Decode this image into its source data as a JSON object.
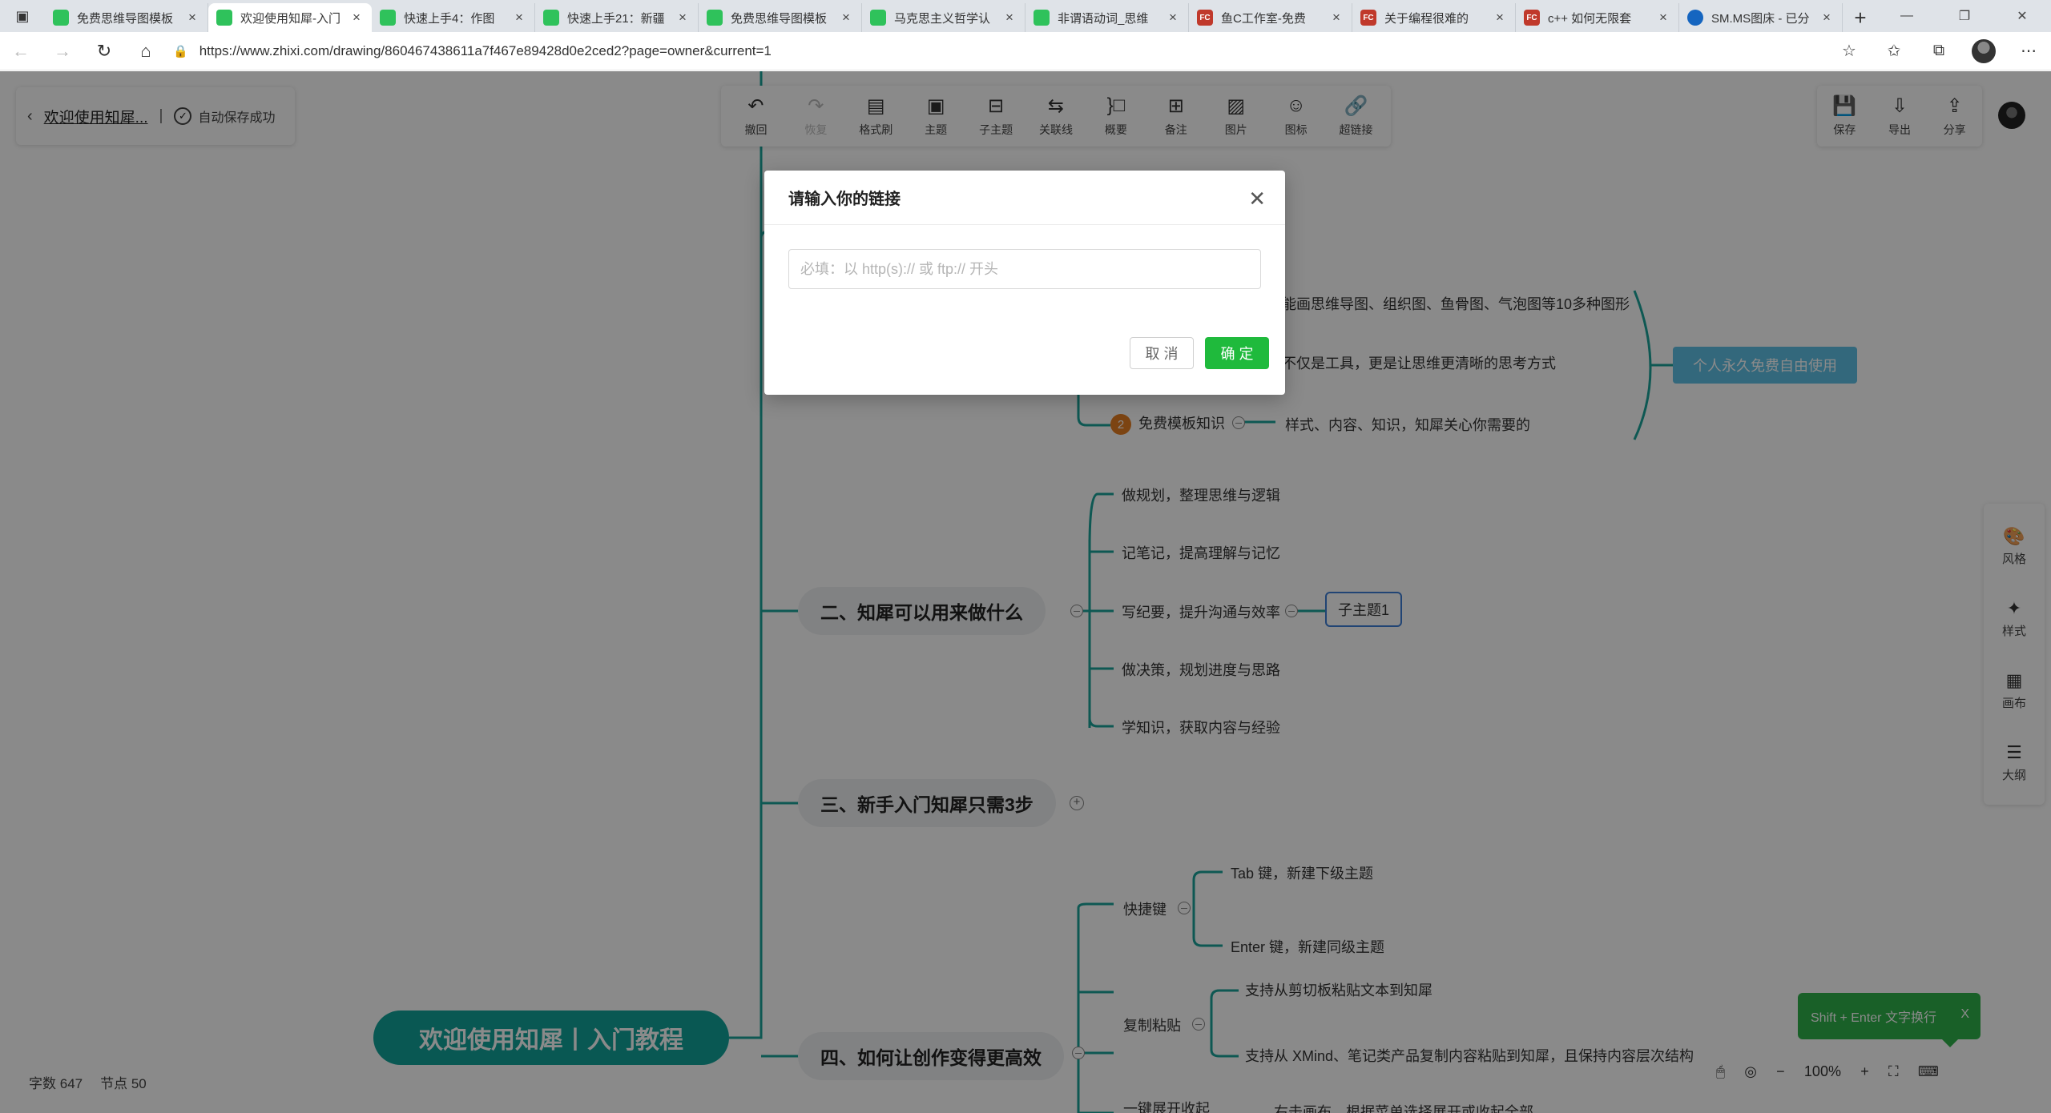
{
  "browser": {
    "tabs": [
      {
        "label": "免费思维导图模板",
        "icon": "green"
      },
      {
        "label": "欢迎使用知犀-入门",
        "icon": "green",
        "active": true
      },
      {
        "label": "快速上手4：作图",
        "icon": "green"
      },
      {
        "label": "快速上手21：新疆",
        "icon": "green"
      },
      {
        "label": "免费思维导图模板",
        "icon": "green"
      },
      {
        "label": "马克思主义哲学认",
        "icon": "green"
      },
      {
        "label": "非谓语动词_思维",
        "icon": "green"
      },
      {
        "label": "鱼C工作室-免费",
        "icon": "red",
        "fav_text": "FC"
      },
      {
        "label": "关于编程很难的",
        "icon": "red",
        "fav_text": "FC"
      },
      {
        "label": "c++ 如何无限套",
        "icon": "red",
        "fav_text": "FC"
      },
      {
        "label": "SM.MS图床 - 已分",
        "icon": "blue"
      }
    ],
    "url": "https://www.zhixi.com/drawing/860467438611a7f467e89428d0e2ced2?page=owner&current=1"
  },
  "doc": {
    "title": "欢迎使用知犀...",
    "separator": "|",
    "save_status": "自动保存成功"
  },
  "toolbar": {
    "undo": "撤回",
    "redo": "恢复",
    "format_brush": "格式刷",
    "topic": "主题",
    "subtopic": "子主题",
    "relation": "关联线",
    "summary": "概要",
    "note": "备注",
    "image": "图片",
    "icon": "图标",
    "hyperlink": "超链接"
  },
  "right_tools": {
    "save": "保存",
    "export": "导出",
    "share": "分享"
  },
  "side_panel": {
    "style": "风格",
    "format": "样式",
    "canvas": "画布",
    "outline": "大纲"
  },
  "stats": {
    "words_label": "字数",
    "words": "647",
    "nodes_label": "节点",
    "nodes": "50"
  },
  "zoom": {
    "level": "100%",
    "minus": "−",
    "plus": "+"
  },
  "hint": {
    "text": "Shift + Enter 文字换行",
    "close": "X"
  },
  "mindmap": {
    "root": "欢迎使用知犀丨入门教程",
    "section1_items": [
      "能画思维导图、组织图、鱼骨图、气泡图等10多种图形",
      "不仅是工具，更是让思维更清晰的思考方式"
    ],
    "free_template": {
      "badge": "2",
      "label": "免费模板知识",
      "child": "样式、内容、知识，知犀关心你需要的"
    },
    "summary": "个人永久免费自由使用",
    "section2": {
      "title": "二、知犀可以用来做什么",
      "items": [
        "做规划，整理思维与逻辑",
        "记笔记，提高理解与记忆",
        "写纪要，提升沟通与效率",
        "做决策，规划进度与思路",
        "学知识，获取内容与经验"
      ],
      "subtopic": "子主题1"
    },
    "section3": {
      "title": "三、新手入门知犀只需3步"
    },
    "section4": {
      "title": "四、如何让创作变得更高效",
      "shortcut": {
        "label": "快捷键",
        "items": [
          "Tab 键，新建下级主题",
          "Enter 键，新建同级主题"
        ]
      },
      "paste": {
        "label": "复制粘贴",
        "items": [
          "支持从剪切板粘贴文本到知犀",
          "支持从 XMind、笔记类产品复制内容粘贴到知犀，且保持内容层次结构"
        ]
      },
      "fold": {
        "label": "一键展开收起",
        "child": "右击画布，根据菜单选择展开或收起全部"
      }
    }
  },
  "modal": {
    "title": "请输入你的链接",
    "close": "✕",
    "placeholder": "必填：以 http(s):// 或 ftp:// 开头",
    "value": "",
    "cancel": "取 消",
    "ok": "确 定"
  }
}
